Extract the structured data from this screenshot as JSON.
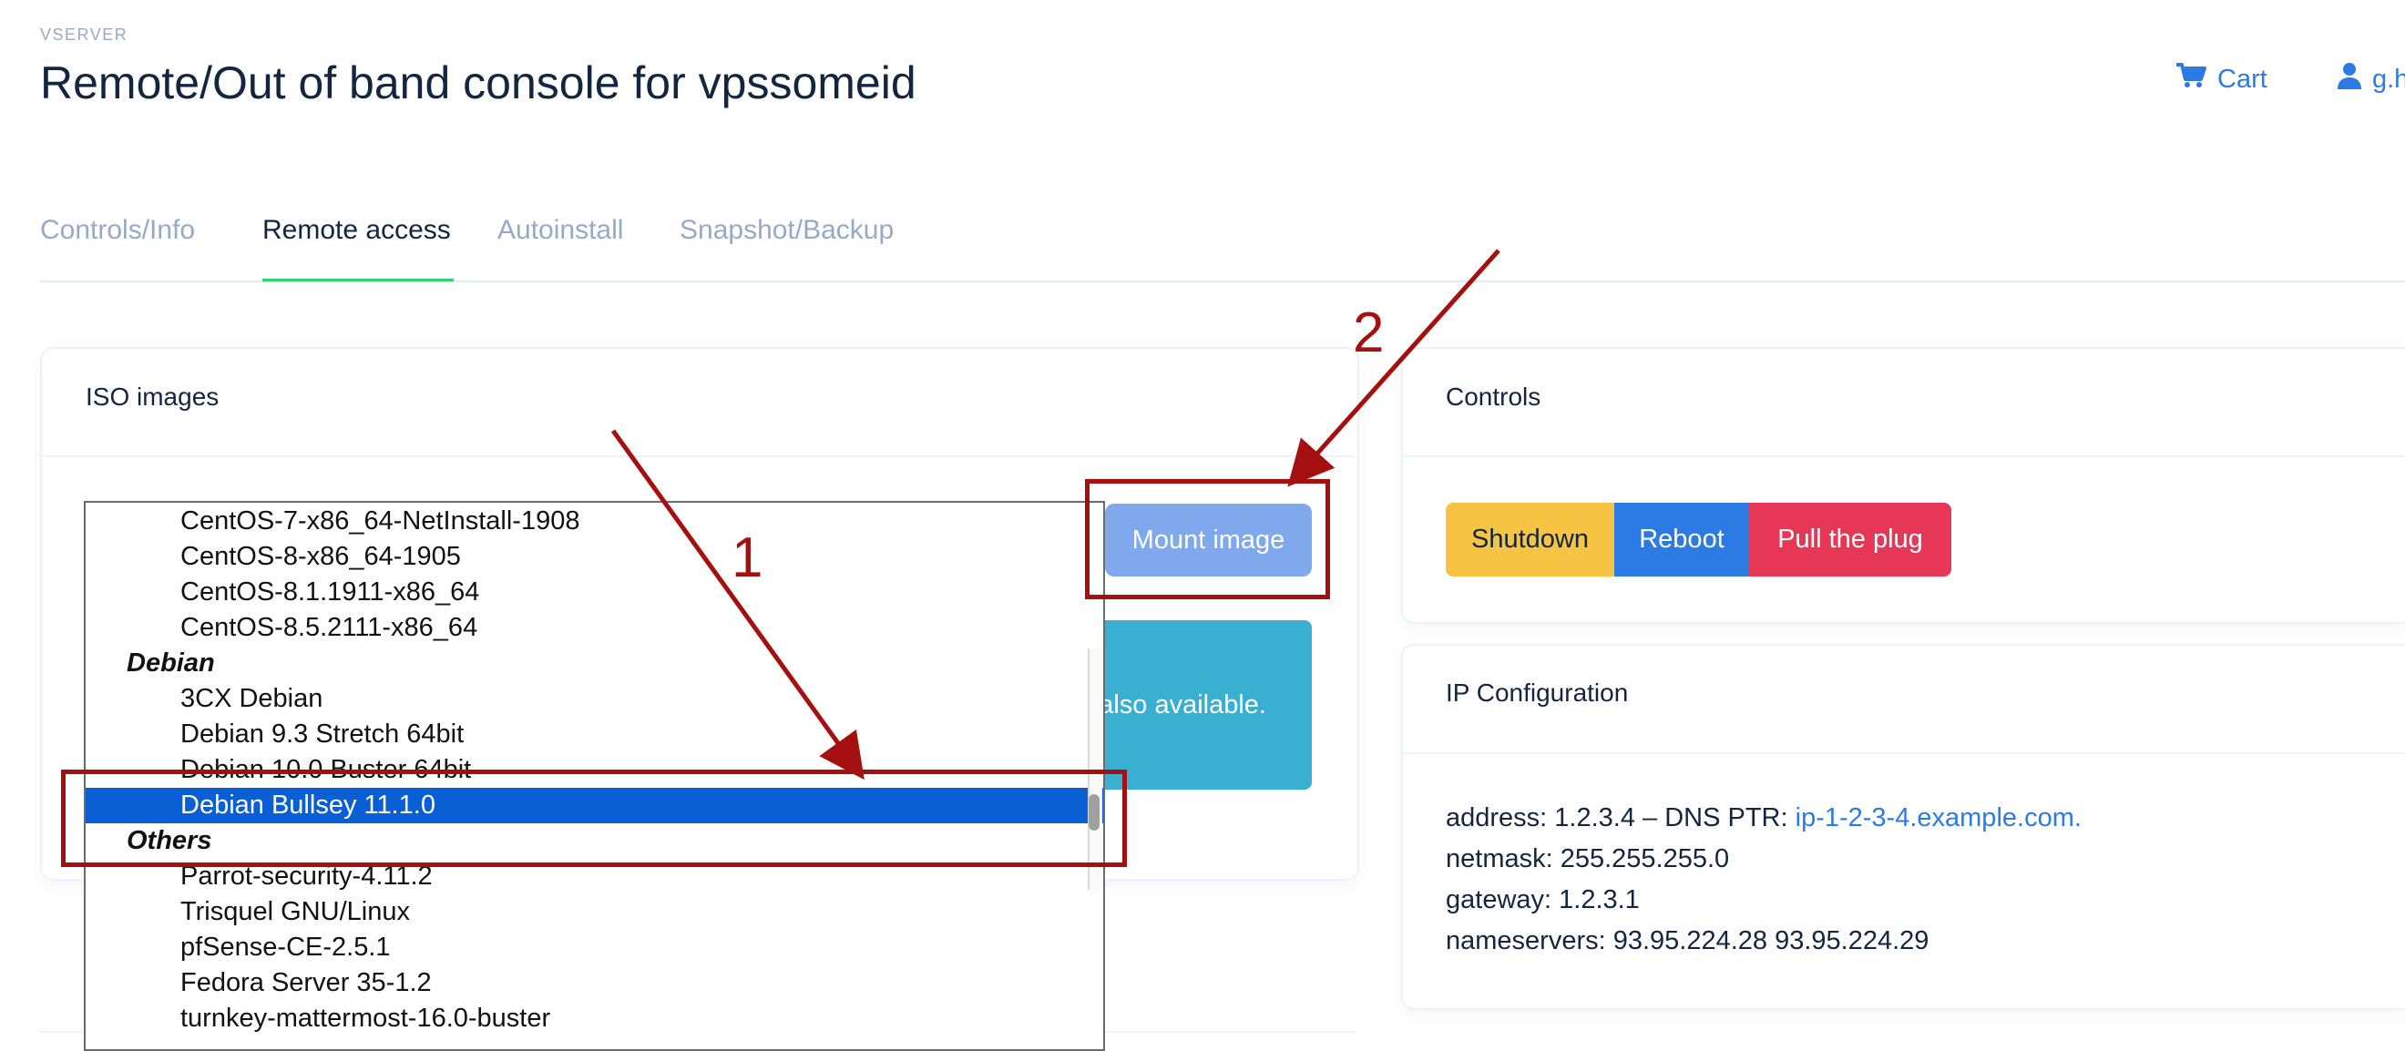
{
  "header": {
    "eyebrow": "VSERVER",
    "title": "Remote/Out of band console for vpssomeid",
    "cart_label": "Cart",
    "user_label": "g.h"
  },
  "tabs": [
    {
      "label": "Controls/Info",
      "active": false
    },
    {
      "label": "Remote access",
      "active": true
    },
    {
      "label": "Autoinstall",
      "active": false
    },
    {
      "label": "Snapshot/Backup",
      "active": false
    }
  ],
  "iso_card": {
    "title": "ISO images",
    "mount_label": "Mount image",
    "info_text": "also available."
  },
  "iso_dropdown": {
    "items": [
      {
        "label": "CentOS-7-x86_64-NetInstall-1908",
        "type": "option"
      },
      {
        "label": "CentOS-8-x86_64-1905",
        "type": "option"
      },
      {
        "label": "CentOS-8.1.1911-x86_64",
        "type": "option"
      },
      {
        "label": "CentOS-8.5.2111-x86_64",
        "type": "option"
      },
      {
        "label": "Debian",
        "type": "group"
      },
      {
        "label": "3CX Debian",
        "type": "option"
      },
      {
        "label": "Debian 9.3 Stretch 64bit",
        "type": "option"
      },
      {
        "label": "Debian 10.0 Buster 64bit",
        "type": "option"
      },
      {
        "label": "Debian Bullsey 11.1.0",
        "type": "option",
        "selected": true
      },
      {
        "label": "Others",
        "type": "group"
      },
      {
        "label": "Parrot-security-4.11.2",
        "type": "option"
      },
      {
        "label": "Trisquel GNU/Linux",
        "type": "option"
      },
      {
        "label": "pfSense-CE-2.5.1",
        "type": "option"
      },
      {
        "label": "Fedora Server 35-1.2",
        "type": "option"
      },
      {
        "label": "turnkey-mattermost-16.0-buster",
        "type": "option"
      }
    ]
  },
  "controls_card": {
    "title": "Controls",
    "shutdown_label": "Shutdown",
    "reboot_label": "Reboot",
    "pull_plug_label": "Pull the plug"
  },
  "ip_card": {
    "title": "IP Configuration",
    "address_prefix": "address: 1.2.3.4 – DNS PTR: ",
    "ptr_link": "ip-1-2-3-4.example.com.",
    "netmask": "netmask: 255.255.255.0",
    "gateway": "gateway: 1.2.3.1",
    "nameservers": "nameservers: 93.95.224.28 93.95.224.29"
  },
  "annotations": {
    "label_1": "1",
    "label_2": "2"
  },
  "colors": {
    "primary": "#2c7be5",
    "warning": "#f6c343",
    "danger": "#e63757",
    "info": "#39afd1",
    "annotation": "#a50f0f",
    "selection": "#0a5fd4"
  }
}
